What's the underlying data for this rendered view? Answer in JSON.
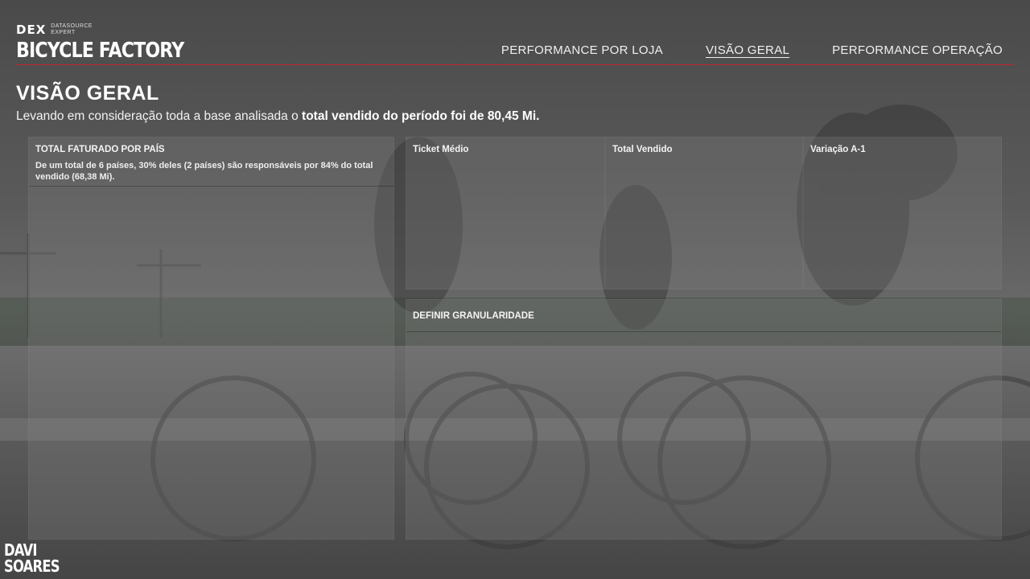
{
  "brand": {
    "logo_mark": "DEX",
    "logo_tagline": [
      "DATASOURCE",
      "EXPERT"
    ],
    "title": "BICYCLE FACTORY"
  },
  "nav": {
    "items": [
      {
        "label": "PERFORMANCE POR LOJA",
        "active": false
      },
      {
        "label": "VISÃO GERAL",
        "active": true
      },
      {
        "label": "PERFORMANCE OPERAÇÃO",
        "active": false
      }
    ]
  },
  "page": {
    "title": "VISÃO GERAL",
    "subtitle_prefix": "Levando em consideração toda a base analisada o ",
    "subtitle_bold": "total vendido do período foi de 80,45 Mi."
  },
  "panels": {
    "country": {
      "title": "TOTAL FATURADO POR PAÍS",
      "text": "De um total de 6 países, 30% deles (2 países) são responsáveis por  84% do total vendido (68,38 Mi)."
    },
    "ticket": {
      "title": "Ticket Médio"
    },
    "total": {
      "title": "Total Vendido"
    },
    "variation": {
      "title": "Variação A-1"
    },
    "granularity": {
      "title": "DEFINIR GRANULARIDADE"
    }
  },
  "footer": {
    "logo_lines": [
      "DAVI",
      "SOARES"
    ]
  },
  "colors": {
    "accent_line": "#c0262b"
  }
}
